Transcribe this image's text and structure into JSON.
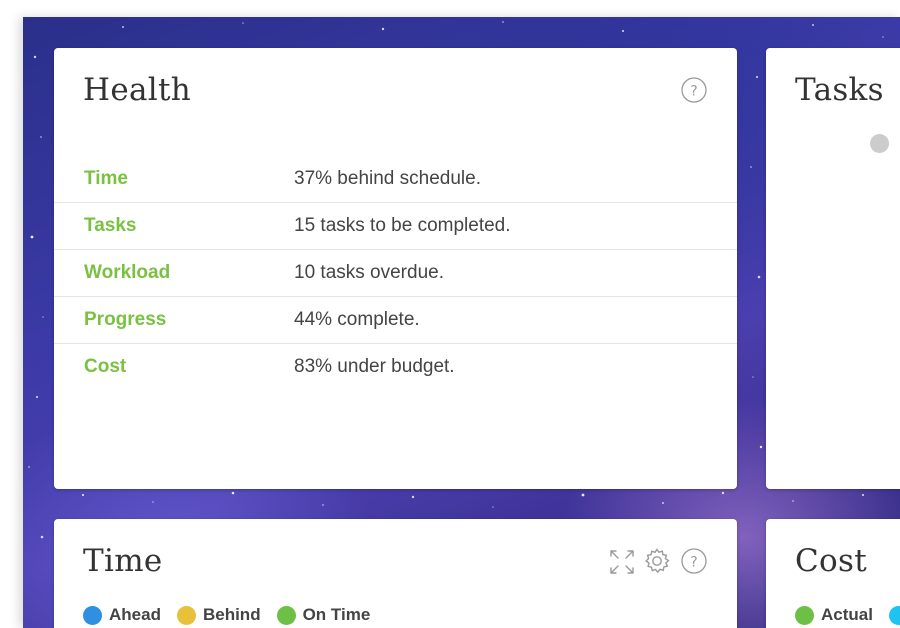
{
  "health": {
    "title": "Health",
    "rows": [
      {
        "label": "Time",
        "value": "37% behind schedule."
      },
      {
        "label": "Tasks",
        "value": "15 tasks to be completed."
      },
      {
        "label": "Workload",
        "value": "10 tasks overdue."
      },
      {
        "label": "Progress",
        "value": "44% complete."
      },
      {
        "label": "Cost",
        "value": "83% under budget."
      }
    ],
    "label_color": "#7ac142"
  },
  "tasks_card": {
    "title": "Tasks",
    "legend_color": "#cccccc"
  },
  "time_card": {
    "title": "Time",
    "legend": [
      {
        "label": "Ahead",
        "color": "#2f8fe0"
      },
      {
        "label": "Behind",
        "color": "#e8c13a"
      },
      {
        "label": "On Time",
        "color": "#6dc045"
      }
    ],
    "icons": [
      "expand-icon",
      "gear-icon",
      "help-icon"
    ]
  },
  "cost_card": {
    "title": "Cost",
    "legend": [
      {
        "label": "Actual",
        "color": "#6dc045"
      },
      {
        "label": "",
        "color": "#1fc3f0"
      }
    ]
  }
}
